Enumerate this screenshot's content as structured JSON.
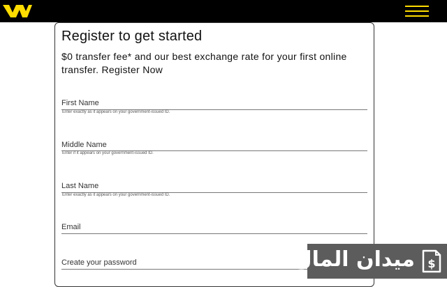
{
  "header": {
    "logo_icon": "western-union-logo-icon",
    "menu_icon": "hamburger-menu-icon",
    "background_color": "#000000",
    "accent_color": "#ffdd00"
  },
  "form": {
    "title": "Register to get started",
    "subtitle": "$0 transfer fee* and our best exchange rate for your first online transfer. Register Now",
    "fields": [
      {
        "label": "First Name",
        "hint": "Enter exactly as it appears on your government-issued ID."
      },
      {
        "label": "Middle Name",
        "hint": "Enter if it appears on your government-issued ID."
      },
      {
        "label": "Last Name",
        "hint": "Enter exactly as it appears on your government-issued ID."
      },
      {
        "label": "Email",
        "hint": ""
      },
      {
        "label": "Create your password",
        "hint": ""
      }
    ]
  },
  "watermark": {
    "text": "ميدان المال",
    "icon": "dollar-document-icon",
    "background_color": "#5c5c5c"
  }
}
